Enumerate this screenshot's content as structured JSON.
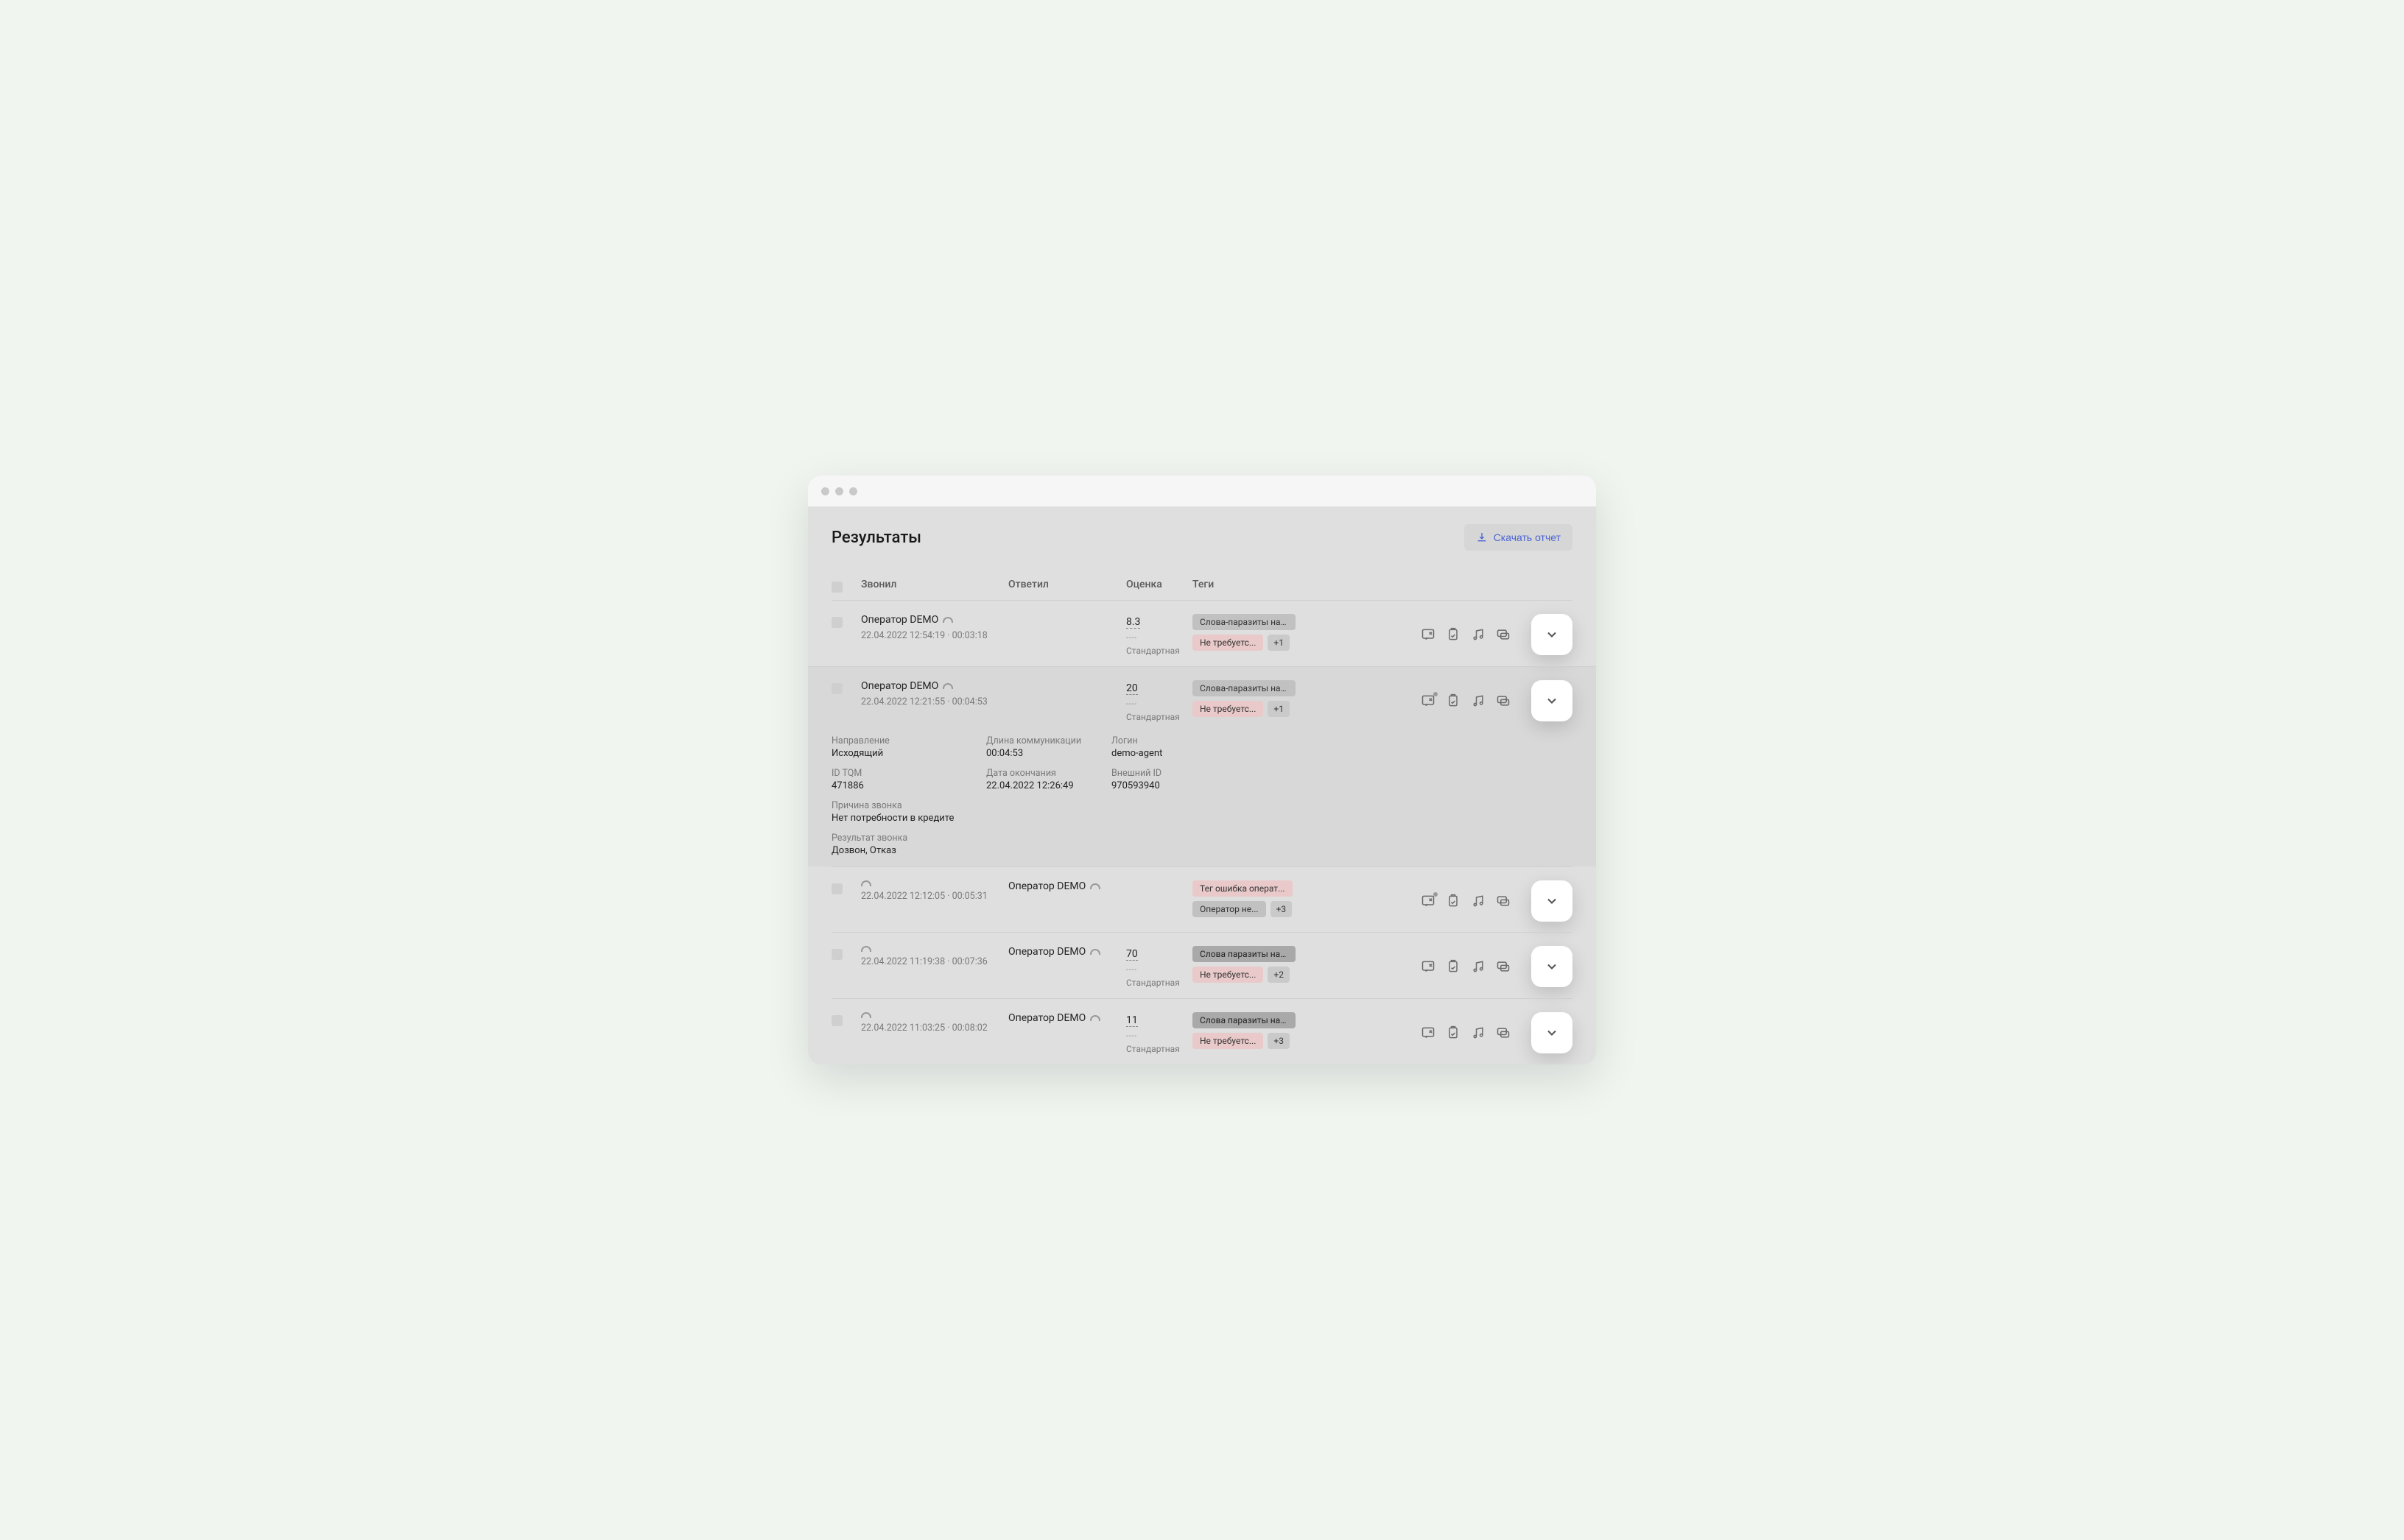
{
  "header": {
    "title": "Результаты",
    "download_label": "Скачать отчет"
  },
  "columns": {
    "caller": "Звонил",
    "answered": "Ответил",
    "score": "Оценка",
    "tags": "Теги"
  },
  "rows": [
    {
      "caller": "Оператор DEMO",
      "meta": "22.04.2022 12:54:19 · 00:03:18",
      "answered": "",
      "score": "8.3",
      "score_label": "Стандартная",
      "tag1": "Слова-паразиты на ...",
      "tag2": "Не требуетс...",
      "extra": "+1",
      "has_badge": false
    },
    {
      "caller": "Оператор DEMO",
      "meta": "22.04.2022 12:21:55 · 00:04:53",
      "answered": "",
      "score": "20",
      "score_label": "Стандартная",
      "tag1": "Слова-паразиты на ...",
      "tag2": "Не требуетс...",
      "extra": "+1",
      "has_badge": true,
      "expanded": true,
      "details": {
        "direction_l": "Направление",
        "direction_v": "Исходящий",
        "length_l": "Длина коммуникации",
        "length_v": "00:04:53",
        "login_l": "Логин",
        "login_v": "demo-agent",
        "id_l": "ID TQM",
        "id_v": "471886",
        "end_l": "Дата окончания",
        "end_v": "22.04.2022 12:26:49",
        "ext_l": "Внешний ID",
        "ext_v": "970593940",
        "reason_l": "Причина звонка",
        "reason_v": "Нет потребности в кредите",
        "result_l": "Результат звонка",
        "result_v": "Дозвон, Отказ"
      }
    },
    {
      "caller": "",
      "meta": "22.04.2022 12:12:05 · 00:05:31",
      "answered": "Оператор DEMO",
      "score": "",
      "score_label": "",
      "tag1": "Тег ошибка операт...",
      "tag1_pink": true,
      "tag2": "Оператор не...",
      "tag2_gray": true,
      "extra": "+3",
      "has_badge": true
    },
    {
      "caller": "",
      "meta": "22.04.2022 11:19:38 · 00:07:36",
      "answered": "Оператор DEMO",
      "score": "70",
      "score_label": "Стандартная",
      "tag1": "Слова паразиты на ...",
      "tag1_dark": true,
      "tag2": "Не требуетс...",
      "extra": "+2",
      "has_badge": false
    },
    {
      "caller": "",
      "meta": "22.04.2022 11:03:25 · 00:08:02",
      "answered": "Оператор DEMO",
      "score": "11",
      "score_label": "Стандартная",
      "tag1": "Слова паразиты на ...",
      "tag1_dark": true,
      "tag2": "Не требуетс...",
      "extra": "+3",
      "has_badge": false
    }
  ]
}
